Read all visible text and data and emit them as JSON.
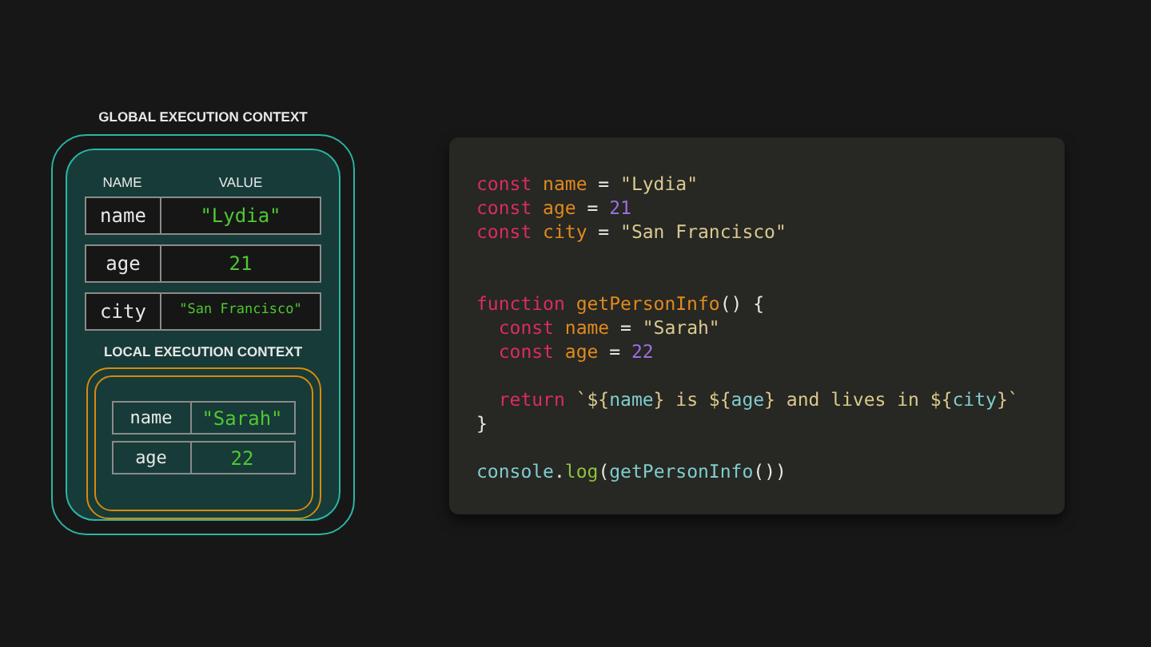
{
  "global_context": {
    "title": "GLOBAL EXECUTION CONTEXT",
    "columns": [
      "NAME",
      "VALUE"
    ],
    "rows": [
      {
        "name": "name",
        "value": "\"Lydia\""
      },
      {
        "name": "age",
        "value": "21"
      },
      {
        "name": "city",
        "value": "\"San Francisco\""
      }
    ]
  },
  "local_context": {
    "title": "LOCAL EXECUTION CONTEXT",
    "rows": [
      {
        "name": "name",
        "value": "\"Sarah\""
      },
      {
        "name": "age",
        "value": "22"
      }
    ]
  },
  "code": {
    "lines": [
      {
        "kind": "code",
        "tokens": [
          {
            "text": "const ",
            "kind": "keyword"
          },
          {
            "text": "name",
            "kind": "variable"
          },
          {
            "text": " = ",
            "kind": "plain"
          },
          {
            "text": "\"Lydia\"",
            "kind": "string"
          }
        ]
      },
      {
        "kind": "code",
        "tokens": [
          {
            "text": "const ",
            "kind": "keyword"
          },
          {
            "text": "age",
            "kind": "variable"
          },
          {
            "text": " = ",
            "kind": "plain"
          },
          {
            "text": "21",
            "kind": "number"
          }
        ]
      },
      {
        "kind": "code",
        "tokens": [
          {
            "text": "const ",
            "kind": "keyword"
          },
          {
            "text": "city",
            "kind": "variable"
          },
          {
            "text": " = ",
            "kind": "plain"
          },
          {
            "text": "\"San Francisco\"",
            "kind": "string"
          }
        ]
      },
      {
        "kind": "blank"
      },
      {
        "kind": "blank"
      },
      {
        "kind": "code",
        "tokens": [
          {
            "text": "function ",
            "kind": "keyword"
          },
          {
            "text": "getPersonInfo",
            "kind": "variable"
          },
          {
            "text": "() {",
            "kind": "plain"
          }
        ]
      },
      {
        "kind": "code",
        "tokens": [
          {
            "text": "  const ",
            "kind": "keyword"
          },
          {
            "text": "name",
            "kind": "variable"
          },
          {
            "text": " = ",
            "kind": "plain"
          },
          {
            "text": "\"Sarah\"",
            "kind": "string"
          }
        ]
      },
      {
        "kind": "code",
        "tokens": [
          {
            "text": "  const ",
            "kind": "keyword"
          },
          {
            "text": "age",
            "kind": "variable"
          },
          {
            "text": " = ",
            "kind": "plain"
          },
          {
            "text": "22",
            "kind": "number"
          }
        ]
      },
      {
        "kind": "blank"
      },
      {
        "kind": "code",
        "tokens": [
          {
            "text": "  return ",
            "kind": "keyword"
          },
          {
            "text": "`${",
            "kind": "string"
          },
          {
            "text": "name",
            "kind": "identifier"
          },
          {
            "text": "} is ${",
            "kind": "string"
          },
          {
            "text": "age",
            "kind": "identifier"
          },
          {
            "text": "} and lives in ${",
            "kind": "string"
          },
          {
            "text": "city",
            "kind": "identifier"
          },
          {
            "text": "}`",
            "kind": "string"
          }
        ]
      },
      {
        "kind": "code",
        "tokens": [
          {
            "text": "}",
            "kind": "plain"
          }
        ]
      },
      {
        "kind": "blank"
      },
      {
        "kind": "code",
        "tokens": [
          {
            "text": "console",
            "kind": "identifier"
          },
          {
            "text": ".",
            "kind": "plain"
          },
          {
            "text": "log",
            "kind": "method"
          },
          {
            "text": "(",
            "kind": "plain"
          },
          {
            "text": "getPersonInfo",
            "kind": "identifier"
          },
          {
            "text": "())",
            "kind": "plain"
          }
        ]
      }
    ]
  }
}
